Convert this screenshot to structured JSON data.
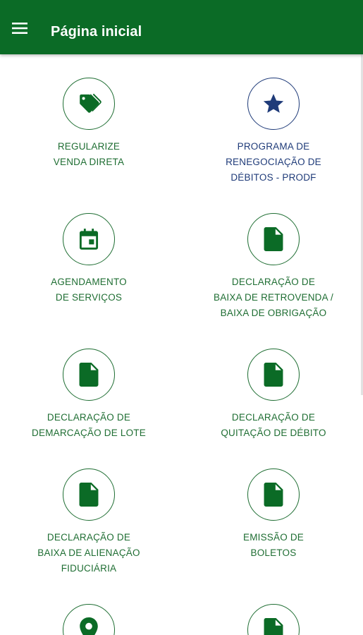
{
  "appbar": {
    "title": "Página inicial",
    "menu_icon": "menu-icon",
    "background_color": "#0b6b26"
  },
  "colors": {
    "green": "#1f6e33",
    "blue": "#1f3b79"
  },
  "tiles": [
    {
      "label": "REGULARIZE\nVENDA DIRETA",
      "icon": "tag-icon"
    },
    {
      "label": "PROGRAMA DE\nRENEGOCIAÇÃO DE\nDÉBITOS - PRODF",
      "icon": "star-icon"
    },
    {
      "label": "AGENDAMENTO\nDE SERVIÇOS",
      "icon": "calendar-icon"
    },
    {
      "label": "DECLARAÇÃO DE\nBAIXA DE RETROVENDA /\nBAIXA DE OBRIGAÇÃO",
      "icon": "document-icon"
    },
    {
      "label": "DECLARAÇÃO DE\nDEMARCAÇÃO DE LOTE",
      "icon": "document-icon"
    },
    {
      "label": "DECLARAÇÃO DE\nQUITAÇÃO DE DÉBITO",
      "icon": "document-icon"
    },
    {
      "label": "DECLARAÇÃO DE\nBAIXA DE ALIENAÇÃO\nFIDUCIÁRIA",
      "icon": "document-icon"
    },
    {
      "label": "EMISSÃO DE\nBOLETOS",
      "icon": "document-icon"
    },
    {
      "label": "",
      "icon": "location-pin-icon"
    },
    {
      "label": "",
      "icon": "document-icon"
    }
  ]
}
